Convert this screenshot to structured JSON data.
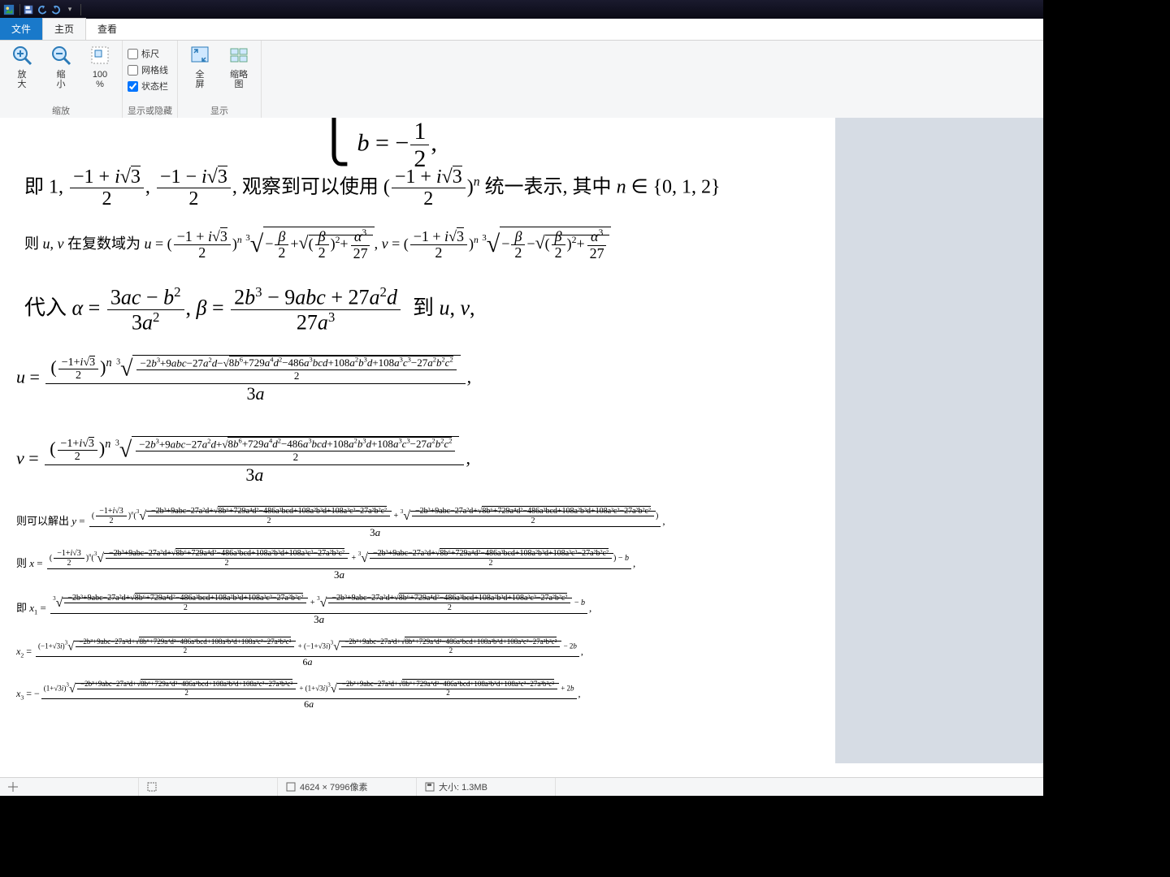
{
  "titlebar": {},
  "tabs": {
    "file": "文件",
    "home": "主页",
    "view": "查看"
  },
  "ribbon": {
    "zoom": {
      "in": "放\n大",
      "out": "缩\n小",
      "hundred": "100\n%",
      "group": "缩放"
    },
    "show": {
      "ruler": "标尺",
      "gridlines": "网格线",
      "statusbar": "状态栏",
      "group": "显示或隐藏",
      "statusbar_checked": true
    },
    "display": {
      "full": "全\n屏",
      "thumb": "缩略\n图",
      "group": "显示"
    }
  },
  "status": {
    "cursor": "",
    "sel": "",
    "dims": "4624 × 7996像素",
    "size": "大小: 1.3MB"
  },
  "doc": {
    "b_eq": "b = −½,",
    "line2_pre": "即 ",
    "line2_vals": "1,  (−1 + i√3)/2 ,  (−1 − i√3)/2",
    "line2_mid": ", 观察到可以使用 (",
    "line2_base": "(−1 + i√3)/2",
    "line2_pow": ")ⁿ 统一表示, 其中 n ∈ {0, 1, 2}",
    "line3_pre": "则 u, v 在复数域为 u = (",
    "line3_uv": "(−1+i√3)/2)ⁿ ∛( −β/2 + √((β/2)²+α³/27) ), v = ((−1+i√3)/2)ⁿ ∛( −β/2 − √((β/2)²+α³/27) )",
    "line4": "代入 α = (3ac − b²)/(3a²), β = (2b³ − 9abc + 27a²d)/(27a³)  到 u, v,",
    "u_expr": "u = [ ((−1+i√3)/2)ⁿ · ∛( (−2b³+9abc−27a²d − √(8b⁶+729a⁴d²−486a³bcd+108a²b³d+108a³c³−27a²b²c²))/2 ) ] / (3a) ,",
    "v_expr": "v = [ ((−1+i√3)/2)ⁿ · ∛( (−2b³+9abc−27a²d + √(8b⁶+729a⁴d²−486a³bcd+108a²b³d+108a³c³−27a²b²c²))/2 ) ] / (3a) ,",
    "y_expr": "则可以解出 y = ((−1+i√3)/2)ⁿ ( ∛((−2b³+9abc−27a²d+√(8b⁶+729a⁴d²−486a³bcd+108a²b³d+108a³c³−27a²b²c²))/2) + ∛((−2b³+9abc−27a²d+√(8b⁶+…−27a²b²c²))/2) ) / (3a) ,",
    "x_expr": "则 x = ((−1+i√3)/2)ⁿ ( ∛((−2b³+9abc−27a²d+√(8b⁶+729a⁴d²−486a³bcd+108a²b³d+108a³c³−27a²b²c²))/2) + ∛((−2b³+9abc−27a²d+√(8b⁶+…−27a²b²c²))/2) ) − b ) / (3a) ,",
    "x1_expr": "即 x₁ = ( ∛((−2b³+9abc−27a²d+√(8b⁶+729a⁴d²−486a³bcd+108a²b³d+108a³c³−27a²b²c²))/2) + ∛((−2b³+9abc−27a²d+√(8b⁶+…−27a²b²c²))/2) − b ) / (3a) ,",
    "x2_expr": "x₂ = ( (−1+√3 i) ∛((−2b³+9abc−27a²d+√(8b⁶+…−27a²b²c²))/2) + (−1+√3 i) ∛((−2b³+9abc−27a²d+√(8b⁶+…−27a²b²c²))/2) − 2b ) / (6a) ,",
    "x3_expr": "x₃ = − ( (1+√3 i) ∛((−2b³+9abc−27a²d+√(8b⁶+…−27a²b²c²))/2) + (1+√3 i) ∛((−2b³+9abc−27a²d+√(8b⁶+…−27a²b²c²))/2) + 2b ) / (6a) ,",
    "big_radicand": "−2b³+9abc−27a²d±√(8b⁶+729a⁴d²−486a³bcd+108a²b³d+108a³c³−27a²b²c²)",
    "big_radicand_short": "8b⁶+729a⁴d²−486a³bcd+108a²b³d+108a³c³−27a²b²c²"
  }
}
